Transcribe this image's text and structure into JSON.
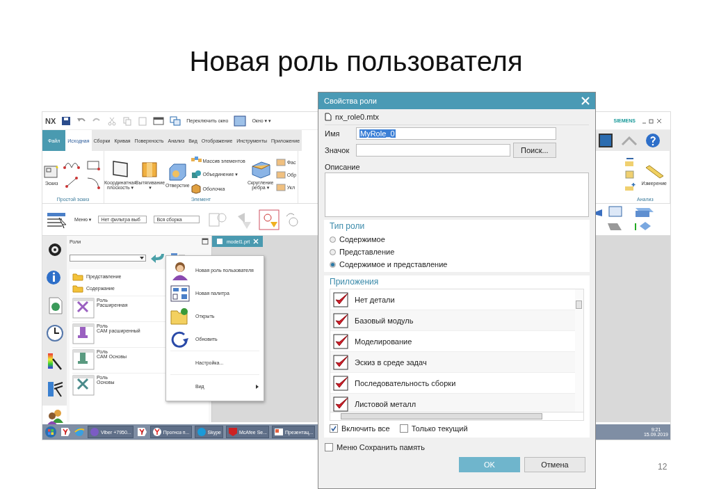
{
  "slide": {
    "title": "Новая роль пользователя",
    "page_number": "12"
  },
  "nx_window": {
    "logo": "NX",
    "quick_access": [
      "Переключить окно",
      "Окно ▾ ▾"
    ],
    "brand": "SIEMENS",
    "ribbon_tabs": [
      {
        "label": "Файл",
        "selected": false,
        "kind": "file"
      },
      {
        "label": "Исходная",
        "selected": true,
        "kind": "tab"
      },
      {
        "label": "Сборки",
        "selected": false,
        "kind": "tab"
      },
      {
        "label": "Кривая",
        "selected": false,
        "kind": "tab"
      },
      {
        "label": "Поверхность",
        "selected": false,
        "kind": "tab"
      },
      {
        "label": "Анализ",
        "selected": false,
        "kind": "tab"
      },
      {
        "label": "Вид",
        "selected": false,
        "kind": "tab"
      },
      {
        "label": "Отображение",
        "selected": false,
        "kind": "tab"
      },
      {
        "label": "Инструменты",
        "selected": false,
        "kind": "tab"
      },
      {
        "label": "Приложение",
        "selected": false,
        "kind": "tab"
      }
    ],
    "ribbon": {
      "sketch_group": {
        "command": "Эскиз",
        "label": "Простой эскиз"
      },
      "feature_group": {
        "commands": [
          "Координатная плоскость ▾",
          "Вытягивание ▾",
          "Отверстие"
        ],
        "small_commands": [
          "Массив элементов",
          "Объединение ▾",
          "Оболочка"
        ],
        "edge_command": "Скругление ребра ▾",
        "cut_commands": [
          "Фас",
          "Обр",
          "Укл"
        ],
        "label": "Элемент"
      },
      "analysis_group": {
        "command": "Измерение",
        "label": "Анализ"
      }
    },
    "selection_bar": {
      "menu": "Меню ▾",
      "filter": "Нет фильтра выб",
      "scope": "Вся сборка"
    },
    "roles_panel": {
      "title": "Роли",
      "folders": [
        "Представление",
        "Содержание"
      ],
      "roles": [
        {
          "line1": "Роль",
          "line2": "Расширенная"
        },
        {
          "line1": "Роль",
          "line2": "CAM расширенный"
        },
        {
          "line1": "Роль",
          "line2": "CAM Основы"
        },
        {
          "line1": "Роль",
          "line2": "Основы"
        }
      ]
    },
    "document_tab": "model1.prt",
    "context_menu": [
      {
        "label": "Новая роль пользователя",
        "kind": "icon"
      },
      {
        "label": "Новая палитра",
        "kind": "icon"
      },
      {
        "label": "Открыть",
        "kind": "icon"
      },
      {
        "label": "Обновить",
        "kind": "icon"
      },
      {
        "label": "Настройка...",
        "kind": "plain"
      },
      {
        "label": "Вид",
        "kind": "submenu"
      }
    ],
    "taskbar": {
      "items": [
        "Viber +7950...",
        "Прогноз п...",
        "Skype",
        "McAfee Se...",
        "Презентац..."
      ],
      "time": "9:21",
      "date": "15.09.2019"
    }
  },
  "dialog": {
    "title": "Свойства роли",
    "file": "nx_role0.mtx",
    "name_label": "Имя",
    "name_value": "MyRole_0",
    "icon_label": "Значок",
    "search_button": "Поиск...",
    "description_label": "Описание",
    "role_type": {
      "title": "Тип роли",
      "options": [
        {
          "label": "Содержимое",
          "selected": false
        },
        {
          "label": "Представление",
          "selected": false
        },
        {
          "label": "Содержимое и представление",
          "selected": true
        }
      ]
    },
    "applications": {
      "title": "Приложения",
      "items": [
        {
          "label": "Нет детали",
          "checked": true
        },
        {
          "label": "Базовый модуль",
          "checked": true
        },
        {
          "label": "Моделирование",
          "checked": true
        },
        {
          "label": "Эскиз в среде задач",
          "checked": true
        },
        {
          "label": "Последовательность сборки",
          "checked": true
        },
        {
          "label": "Листовой металл",
          "checked": true
        }
      ],
      "include_all": {
        "label": "Включить все",
        "checked": true
      },
      "current_only": {
        "label": "Только текущий",
        "checked": false
      }
    },
    "save_menu": {
      "label": "Меню Сохранить память",
      "checked": false
    },
    "buttons": [
      "OK",
      "Отмена"
    ]
  }
}
